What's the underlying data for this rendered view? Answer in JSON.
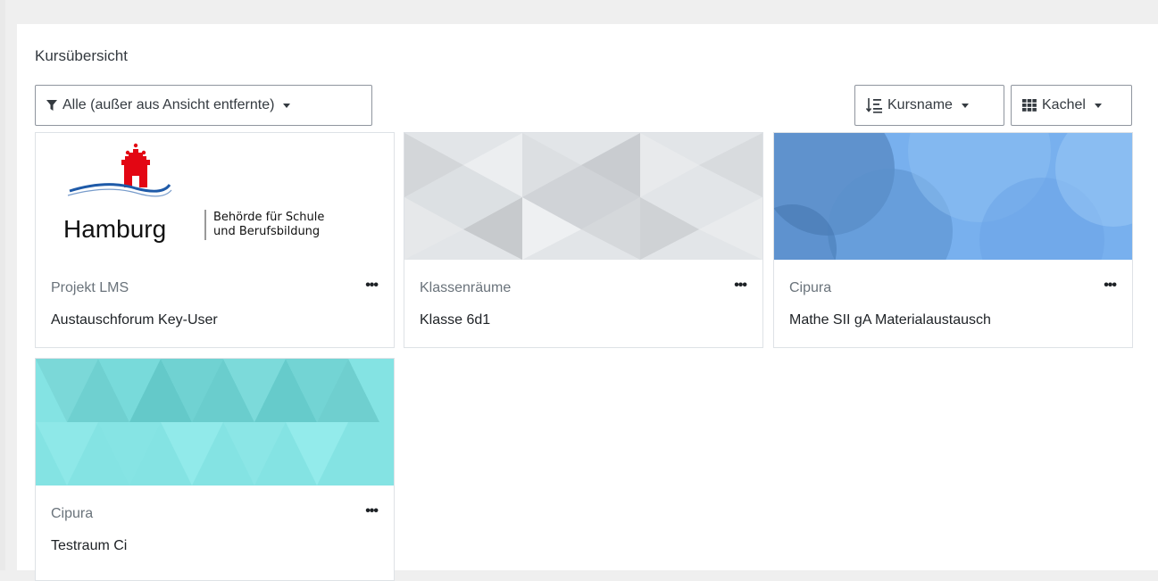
{
  "page": {
    "title": "Kursübersicht"
  },
  "toolbar": {
    "filter_label": "Alle (außer aus Ansicht entfernte)",
    "sort_label": "Kursname",
    "view_label": "Kachel"
  },
  "courses": [
    {
      "category": "Projekt LMS",
      "name": "Austauschforum Key-User",
      "menu": "•••",
      "image": "hamburg-logo",
      "logo": {
        "city": "Hamburg",
        "line1": "Behörde für Schule",
        "line2": "und Berufsbildung"
      }
    },
    {
      "category": "Klassenräume",
      "name": "Klasse 6d1",
      "menu": "•••",
      "image": "grey-triangle-pattern"
    },
    {
      "category": "Cipura",
      "name": "Mathe SII gA Materialaustausch",
      "menu": "•••",
      "image": "blue-circle-pattern"
    },
    {
      "category": "Cipura",
      "name": "Testraum Ci",
      "menu": "•••",
      "image": "teal-triangle-pattern"
    }
  ],
  "colors": {
    "background": "#efefef",
    "panel": "#ffffff",
    "border": "#dee2e6",
    "grey_pattern": "#d6dadd",
    "blue_pattern": "#6fa8e8",
    "teal_pattern": "#84e3e3",
    "hamburg_red": "#e30613",
    "hamburg_blue": "#1e5aa8"
  }
}
